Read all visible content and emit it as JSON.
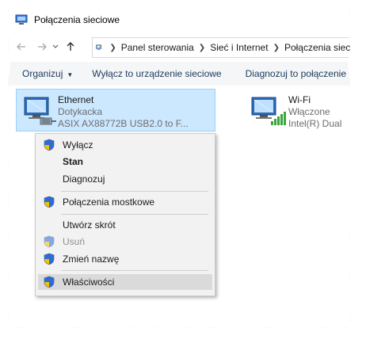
{
  "window": {
    "title": "Połączenia sieciowe"
  },
  "nav": {
    "back_icon": "arrow-left-icon",
    "forward_icon": "arrow-right-icon",
    "recent_icon": "chevron-down-icon",
    "up_icon": "arrow-up-icon"
  },
  "breadcrumb": [
    "Panel sterowania",
    "Sieć i Internet",
    "Połączenia sieci"
  ],
  "toolbar": {
    "organize": "Organizuj",
    "disable": "Wyłącz to urządzenie sieciowe",
    "diagnose": "Diagnozuj to połączenie"
  },
  "adapters": [
    {
      "name": "Ethernet",
      "status": "Dotykacka",
      "device": "ASIX AX88772B USB2.0 to F...",
      "icon": "ethernet-adapter-icon"
    },
    {
      "name": "Wi-Fi",
      "status": "Włączone",
      "device": "Intel(R) Dual",
      "icon": "wifi-adapter-icon"
    }
  ],
  "context_menu": {
    "items": [
      {
        "label": "Wyłącz",
        "shield": true,
        "style": "normal"
      },
      {
        "label": "Stan",
        "shield": false,
        "style": "bold"
      },
      {
        "label": "Diagnozuj",
        "shield": false,
        "style": "normal"
      },
      {
        "label": "Połączenia mostkowe",
        "shield": true,
        "style": "normal"
      },
      {
        "label": "Utwórz skrót",
        "shield": false,
        "style": "normal"
      },
      {
        "label": "Usuń",
        "shield": true,
        "style": "disabled"
      },
      {
        "label": "Zmień nazwę",
        "shield": true,
        "style": "normal"
      },
      {
        "label": "Właściwości",
        "shield": true,
        "style": "highlighted"
      }
    ]
  },
  "colors": {
    "selection": "#cce8ff",
    "toolbar_text": "#1e395b",
    "menu_bg": "#f2f2f2",
    "menu_highlight": "#dadada"
  }
}
